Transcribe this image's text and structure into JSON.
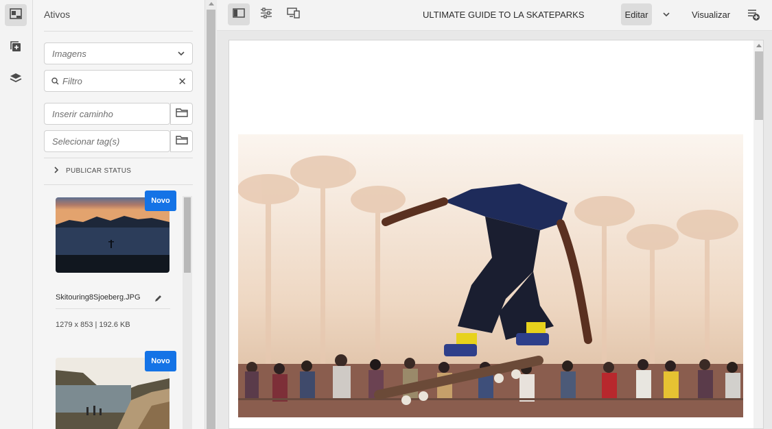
{
  "rail": {
    "items": [
      {
        "icon": "asset-finder-icon",
        "active": true
      },
      {
        "icon": "components-icon",
        "active": false
      },
      {
        "icon": "layers-icon",
        "active": false
      }
    ]
  },
  "panel": {
    "title": "Ativos",
    "type_select": {
      "value": "Imagens"
    },
    "filter": {
      "placeholder": "Filtro"
    },
    "path": {
      "placeholder": "Inserir caminho"
    },
    "tags": {
      "placeholder": "Selecionar tag(s)"
    },
    "publish_status": "PUBLICAR STATUS",
    "assets": [
      {
        "name": "Skitouring8Sjoeberg.JPG",
        "badge": "Novo",
        "meta": "1279 x 853 | 192.6 KB"
      },
      {
        "name": "",
        "badge": "Novo",
        "meta": ""
      }
    ]
  },
  "toolbar": {
    "page_title": "ULTIMATE GUIDE TO LA SKATEPARKS",
    "edit_label": "Editar",
    "preview_label": "Visualizar"
  },
  "colors": {
    "accent": "#1473e6",
    "rail_bg": "#f3f3f3",
    "active_bg": "#dcdcdc"
  }
}
